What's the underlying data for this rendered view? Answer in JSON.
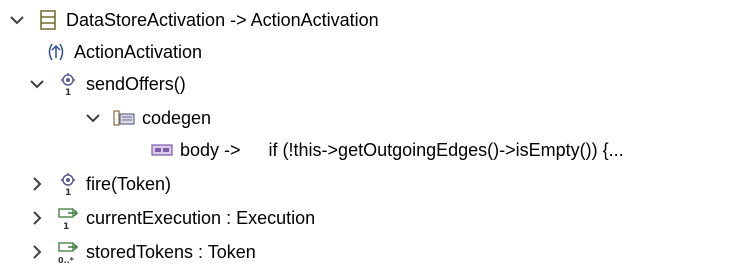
{
  "tree": {
    "root": {
      "label": "DataStoreActivation -> ActionActivation",
      "icon": "class-icon",
      "expanded": true
    },
    "superclass": {
      "label": "ActionActivation",
      "icon": "generalization-icon"
    },
    "method_send_offers": {
      "label": "sendOffers()",
      "icon": "operation-icon",
      "expanded": true
    },
    "codegen": {
      "label": "codegen",
      "icon": "stereotype-icon",
      "expanded": true
    },
    "body": {
      "label": "body ->",
      "value": "if (!this->getOutgoingEdges()->isEmpty()) {...",
      "icon": "property-value-icon"
    },
    "method_fire": {
      "label": "fire(Token)",
      "icon": "operation-icon",
      "expanded": false
    },
    "attr_current_execution": {
      "label": "currentExecution : Execution",
      "icon": "attribute-single-icon",
      "expanded": false
    },
    "attr_stored_tokens": {
      "label": "storedTokens : Token",
      "icon": "attribute-multi-icon",
      "expanded": false
    }
  },
  "colors": {
    "chevron": "#404040",
    "class_icon": "#6b6b2f",
    "operation_icon": "#5a5a8c",
    "generalization_icon": "#2d4fa0",
    "stereotype_icon": "#8a6d3b",
    "property_value_icon": "#7a5ca8",
    "attribute_icon": "#3a7a3a"
  }
}
